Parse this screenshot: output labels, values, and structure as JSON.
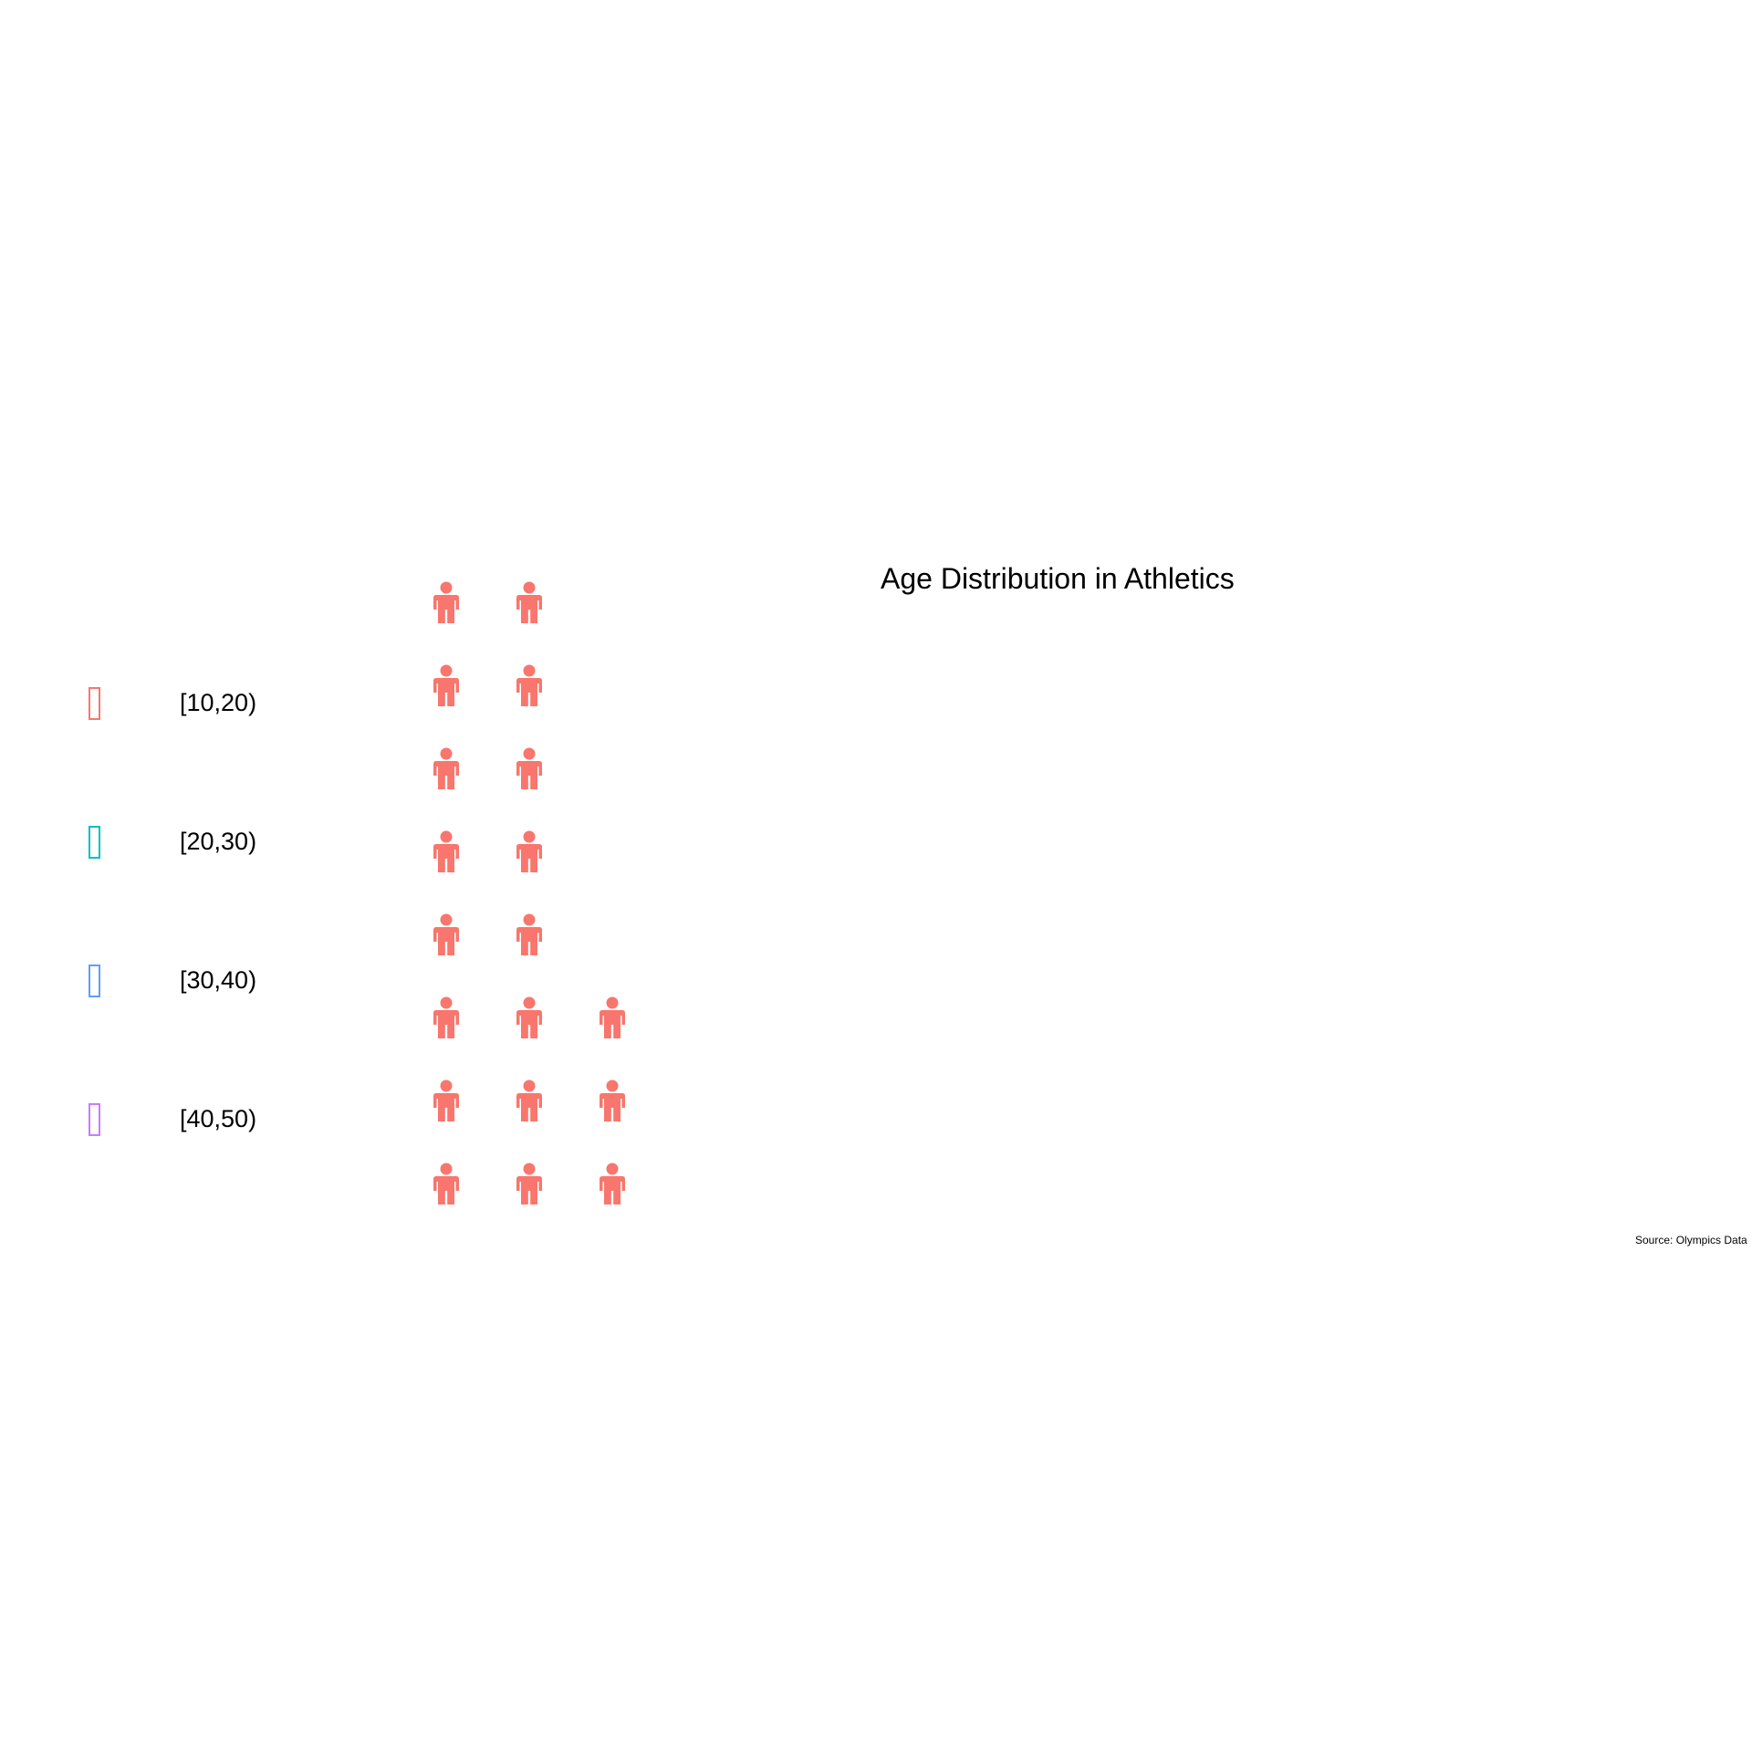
{
  "chart_data": {
    "type": "pictogram",
    "title": "Age Distribution in Athletics",
    "caption": "Source: Olympics Data",
    "icon": "person-icon",
    "legend": [
      {
        "label": "[10,20)",
        "color": "#f8766d"
      },
      {
        "label": "[20,30)",
        "color": "#00bfc4"
      },
      {
        "label": "[30,40)",
        "color": "#619cff"
      },
      {
        "label": "[40,50)",
        "color": "#c77cff"
      }
    ],
    "columns": [
      {
        "count": 8,
        "category": "[10,20)"
      },
      {
        "count": 8,
        "category": "[10,20)"
      },
      {
        "count": 3,
        "category": "[10,20)"
      }
    ],
    "legend_placement": "left",
    "grid": false
  }
}
